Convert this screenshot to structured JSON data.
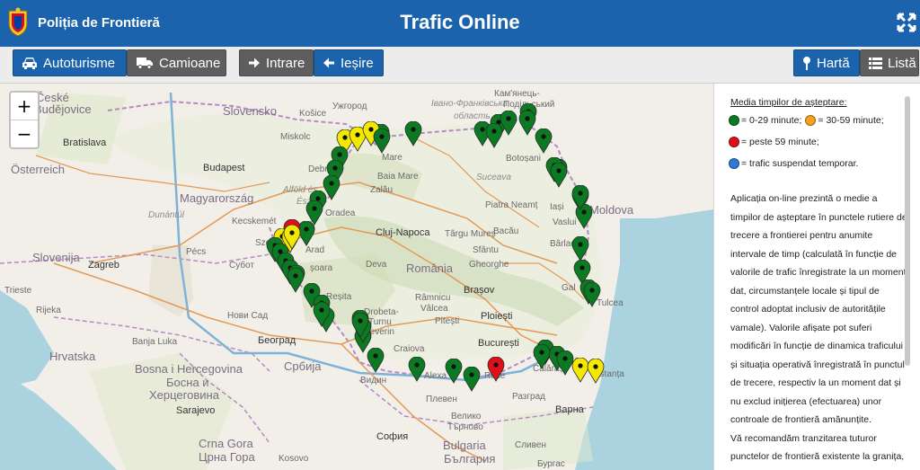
{
  "header": {
    "brand_label": "Poliția de Frontieră",
    "title": "Trafic Online"
  },
  "toolbar": {
    "cars_label": "Autoturisme",
    "trucks_label": "Camioane",
    "entry_label": "Intrare",
    "exit_label": "Ieșire",
    "map_label": "Hartă",
    "list_label": "Listă"
  },
  "map": {
    "zoom_in": "+",
    "zoom_out": "−",
    "labels": {
      "ceske": "České",
      "ceske2": "Budějovice",
      "slovensko": "Slovensko",
      "kosice": "Košice",
      "uzhorod": "Ужгород",
      "ivano": "Івано-Франківська",
      "oblast": "область",
      "kamianets": "Кам'янець-",
      "podilskyi": "Подільський",
      "bratislava": "Bratislava",
      "miskolc": "Miskolc",
      "satu": "Mare",
      "botosani": "Botoșani",
      "osterreich": "Österreich",
      "budapest": "Budapest",
      "debrecen": "Debre",
      "baia": "Baia Mare",
      "suceava": "Suceava",
      "alfold": "Alföld és",
      "eszak": "Észak",
      "magyarorszag": "Magyarország",
      "zalau": "Zalău",
      "oradea": "Oradea",
      "piatra": "Piatra Neamț",
      "iasi": "Iași",
      "moldova": "Moldova",
      "vaslui": "Vaslui",
      "dunantul": "Dunántúl",
      "kecskemet": "Kecskemét",
      "cluj": "Cluj-Napoca",
      "targu": "Târgu Mureș",
      "bacau": "Bacău",
      "barlad": "Bârlad",
      "szeged": "Sze",
      "arad": "Arad",
      "sfantu": "Sfântu",
      "gheorghe": "Gheorghe",
      "romania": "România",
      "slovenija": "Slovenija",
      "pecs": "Pécs",
      "subotica": "Субот",
      "timisoara": "șoara",
      "deva": "Deva",
      "zagreb": "Zagreb",
      "brasov": "Brașov",
      "galati": "Gal",
      "trieste": "Trieste",
      "resita": "Reșita",
      "ramnicu": "Râmnicu",
      "valcea": "Vâlcea",
      "tulcea": "Tulcea",
      "rijeka": "Rijeka",
      "drobeta": "Drobeta-",
      "turnu": "Turnu",
      "severin": "Severin",
      "pitesti": "Pitești",
      "ploiesti": "Ploiești",
      "novisad": "Нови Сад",
      "banjaluka": "Banja Luka",
      "beograd": "Београд",
      "bucuresti": "București",
      "hrvatska": "Hrvatska",
      "craiova": "Craiova",
      "calarasi": "Călărași",
      "constanta": "nstanța",
      "srbija": "Србија",
      "bosna": "Bosna i Hercegovina",
      "bosna2": "Босна и",
      "bosna3": "Херцеговина",
      "sarajevo": "Sarajevo",
      "vidin": "Видин",
      "alexandria": "Alexa",
      "ruse": "Ruse",
      "razgrad": "Разград",
      "pleven": "Плевен",
      "varna": "Варна",
      "veliko": "Велико",
      "tarnovo": "Търново",
      "crnagora": "Crna Gora",
      "crnagora2": "Црна Гора",
      "sofia": "София",
      "bulgaria": "Bulgaria",
      "bulgaria2": "България",
      "sliven": "Сливен",
      "burgas": "Бургас",
      "kosovo": "Kosovo"
    },
    "markers": [
      {
        "status": "green"
      },
      {
        "status": "green"
      },
      {
        "status": "green"
      },
      {
        "status": "green"
      },
      {
        "status": "green"
      },
      {
        "status": "green"
      },
      {
        "status": "green"
      },
      {
        "status": "green"
      },
      {
        "status": "green"
      },
      {
        "status": "green"
      },
      {
        "status": "green"
      },
      {
        "status": "green"
      },
      {
        "status": "yellow"
      },
      {
        "status": "yellow"
      },
      {
        "status": "yellow"
      },
      {
        "status": "green"
      },
      {
        "status": "green"
      },
      {
        "status": "green"
      },
      {
        "status": "green"
      },
      {
        "status": "green"
      },
      {
        "status": "green"
      },
      {
        "status": "green"
      },
      {
        "status": "yellow"
      },
      {
        "status": "red"
      },
      {
        "status": "yellow"
      },
      {
        "status": "green"
      },
      {
        "status": "green"
      },
      {
        "status": "green"
      },
      {
        "status": "green"
      },
      {
        "status": "green"
      },
      {
        "status": "green"
      },
      {
        "status": "green"
      },
      {
        "status": "green"
      },
      {
        "status": "green"
      },
      {
        "status": "green"
      },
      {
        "status": "green"
      },
      {
        "status": "green"
      },
      {
        "status": "green"
      },
      {
        "status": "green"
      },
      {
        "status": "red"
      },
      {
        "status": "green"
      },
      {
        "status": "green"
      },
      {
        "status": "green"
      },
      {
        "status": "green"
      },
      {
        "status": "yellow"
      },
      {
        "status": "yellow"
      },
      {
        "status": "green"
      },
      {
        "status": "green"
      },
      {
        "status": "green"
      },
      {
        "status": "green"
      },
      {
        "status": "green"
      },
      {
        "status": "green"
      },
      {
        "status": "green"
      },
      {
        "status": "green"
      },
      {
        "status": "green"
      },
      {
        "status": "green"
      },
      {
        "status": "green"
      },
      {
        "status": "yellow"
      },
      {
        "status": "green"
      }
    ]
  },
  "legend": {
    "title": "Media timpilor de așteptare:",
    "green": "= 0-29 minute;",
    "yellow": "= 30-59 minute;",
    "red": "= peste 59 minute;",
    "blue": "= trafic suspendat temporar.",
    "description": "Aplicația on-line prezintă o medie a timpilor de așteptare în punctele rutiere de trecere a frontierei pentru anumite intervale de timp (calculată în funcție de valorile de trafic înregistrate la un moment dat, circumstanțele locale și tipul de control adoptat inclusiv de autoritățile vamale). Valorile afișate pot suferi modificări în funcție de dinamica traficului și situația operativă înregistrată în punctul de trecere, respectiv la un moment dat și nu exclud inițierea (efectuarea) unor controale de frontieră amănunțite.",
    "recommendation": "Vă recomandăm tranzitarea tuturor punctelor de frontieră existente la granița,"
  },
  "colors": {
    "header": "#1b63ad",
    "green": "#0b7a22",
    "yellow": "#f2e800",
    "red": "#e0101a",
    "blue": "#2f78d8",
    "orange": "#f7a21c"
  }
}
